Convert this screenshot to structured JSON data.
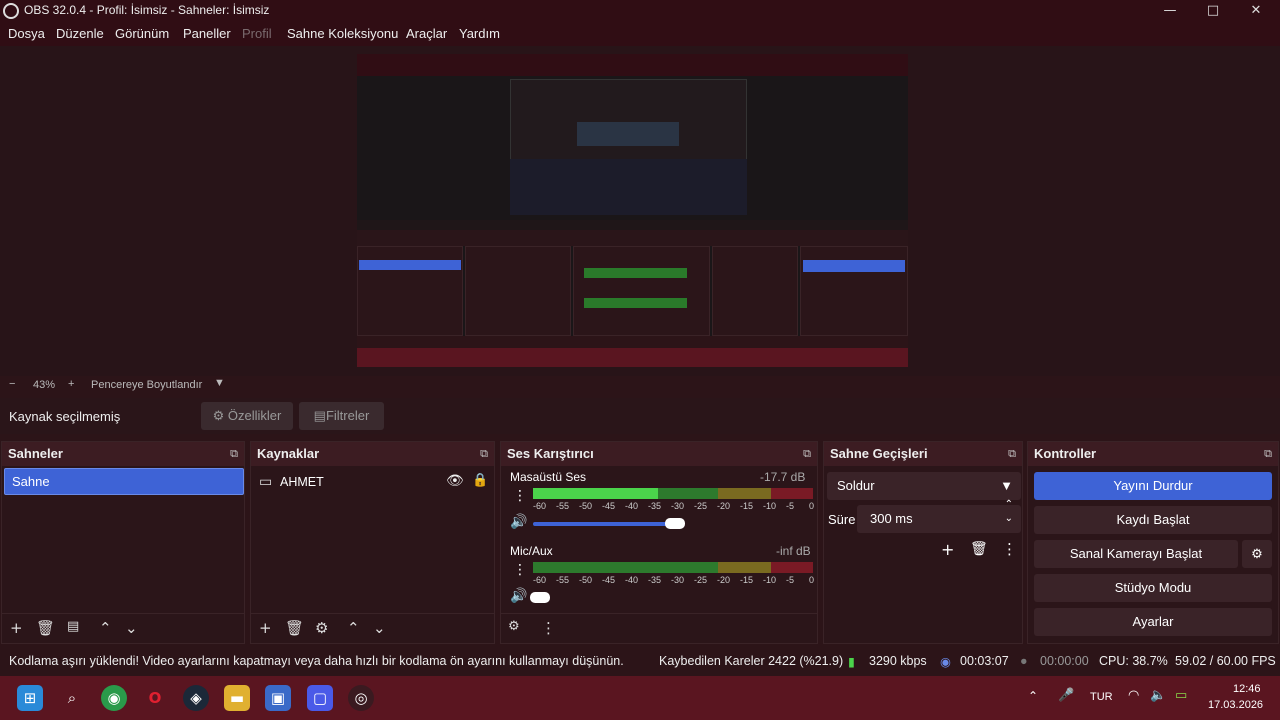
{
  "window": {
    "title": "OBS 32.0.4 - Profil: İsimsiz - Sahneler: İsimsiz",
    "min": "—",
    "max": "□",
    "close": "✕"
  },
  "menu": [
    "Dosya",
    "Düzenle",
    "Görünüm",
    "Paneller",
    "Profil",
    "Sahne Koleksiyonu",
    "Araçlar",
    "Yardım"
  ],
  "zoom": {
    "minus": "−",
    "value": "43%",
    "plus": "+",
    "mode": "Pencereye Boyutlandır"
  },
  "source_bar": {
    "status": "Kaynak seçilmemiş",
    "properties": "Özellikler",
    "filters": "Filtreler"
  },
  "scenes": {
    "title": "Sahneler",
    "items": [
      "Sahne"
    ]
  },
  "sources": {
    "title": "Kaynaklar",
    "items": [
      "AHMET"
    ]
  },
  "mixer": {
    "title": "Ses Karıştırıcı",
    "channels": [
      {
        "name": "Masaüstü Ses",
        "level": "-17.7 dB",
        "volume": 0.95
      },
      {
        "name": "Mic/Aux",
        "level": "-inf dB",
        "volume": 0.0
      }
    ],
    "ticks": [
      "-60",
      "-55",
      "-50",
      "-45",
      "-40",
      "-35",
      "-30",
      "-25",
      "-20",
      "-15",
      "-10",
      "-5",
      "0"
    ]
  },
  "transitions": {
    "title": "Sahne Geçişleri",
    "type": "Soldur",
    "duration_label": "Süre",
    "duration": "300 ms"
  },
  "controls": {
    "title": "Kontroller",
    "stop_stream": "Yayını Durdur",
    "start_record": "Kaydı Başlat",
    "virtual_cam": "Sanal Kamerayı Başlat",
    "studio": "Stüdyo Modu",
    "settings": "Ayarlar"
  },
  "status": {
    "message": "Kodlama aşırı yüklendi! Video ayarlarını kapatmayı veya daha hızlı bir kodlama ön ayarını kullanmayı düşünün.",
    "dropped": "Kaybedilen Kareler 2422 (%21.9)",
    "bitrate": "3290 kbps",
    "stream_time": "00:03:07",
    "rec_time": "00:00:00",
    "cpu": "CPU: 38.7%",
    "fps": "59.02 / 60.00 FPS"
  },
  "taskbar": {
    "lang": "TUR",
    "time": "12:46",
    "date": "17.03.2026"
  },
  "colors": {
    "accent": "#3e63d6",
    "bg": "#2b1519"
  }
}
